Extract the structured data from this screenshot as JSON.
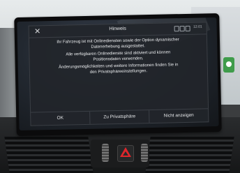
{
  "dialog": {
    "title": "Hinweis",
    "clock": "12:01",
    "lines": [
      "Ihr Fahrzeug ist mit Onlinediensten sowie der Option dynamischer",
      "Datenerhebung ausgestattet.",
      "Alle verfügbaren Onlinedienste sind aktiviert und können",
      "Positionsdaten verwenden.",
      "Änderungsmöglichkeiten und weitere Informationen finden Sie in",
      "den Privatsphäreeinstellungen."
    ],
    "buttons": {
      "ok": "OK",
      "privacy": "Zu Privatsphäre",
      "dismiss": "Nicht anzeigen"
    }
  },
  "icons": {
    "close": "close-icon",
    "hazard": "hazard-warning-icon"
  },
  "colors": {
    "dialog_bg": "#22252a",
    "text": "#eceef0",
    "hazard_red": "#e0262b"
  }
}
